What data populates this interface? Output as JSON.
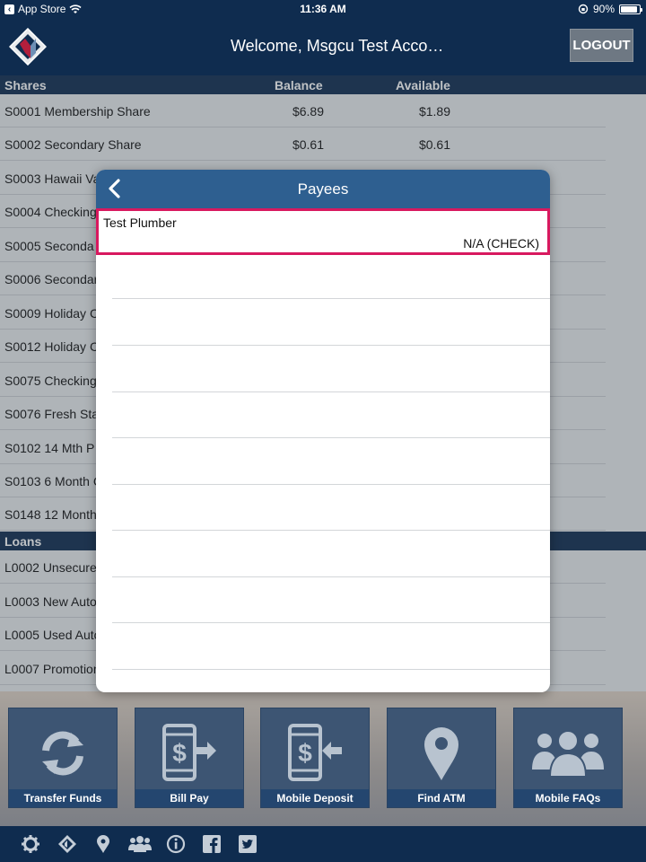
{
  "status_bar": {
    "back_app": "App Store",
    "time": "11:36 AM",
    "battery": "90%",
    "battery_level": 0.9
  },
  "header": {
    "welcome": "Welcome, Msgcu Test Acco…",
    "logout_label": "LOGOUT"
  },
  "shares": {
    "title": "Shares",
    "col_balance": "Balance",
    "col_available": "Available",
    "rows": [
      {
        "name": "S0001 Membership Share",
        "balance": "$6.89",
        "available": "$1.89"
      },
      {
        "name": "S0002 Secondary Share",
        "balance": "$0.61",
        "available": "$0.61"
      },
      {
        "name": "S0003 Hawaii Va",
        "balance": "",
        "available": ""
      },
      {
        "name": "S0004 Checking",
        "balance": "",
        "available": ""
      },
      {
        "name": "S0005 Seconda",
        "balance": "",
        "available": ""
      },
      {
        "name": "S0006 Secondar",
        "balance": "",
        "available": ""
      },
      {
        "name": "S0009 Holiday C",
        "balance": "",
        "available": ""
      },
      {
        "name": "S0012 Holiday C",
        "balance": "",
        "available": ""
      },
      {
        "name": "S0075 Checking",
        "balance": "",
        "available": ""
      },
      {
        "name": "S0076 Fresh Sta",
        "balance": "",
        "available": ""
      },
      {
        "name": "S0102 14 Mth P",
        "balance": "",
        "available": ""
      },
      {
        "name": "S0103 6 Month C",
        "balance": "",
        "available": ""
      },
      {
        "name": "S0148 12 Month",
        "balance": "",
        "available": ""
      }
    ]
  },
  "loans": {
    "title": "Loans",
    "rows": [
      {
        "name": "L0002 Unsecure"
      },
      {
        "name": "L0003 New Auto"
      },
      {
        "name": "L0005 Used Auto"
      },
      {
        "name": "L0007 Promotion"
      }
    ]
  },
  "modal": {
    "title": "Payees",
    "payee": {
      "name": "Test Plumber",
      "type": "N/A (CHECK)"
    }
  },
  "tiles": [
    {
      "label": "Transfer Funds",
      "icon": "refresh-icon"
    },
    {
      "label": "Bill Pay",
      "icon": "phone-dollar-out-icon"
    },
    {
      "label": "Mobile Deposit",
      "icon": "phone-dollar-in-icon"
    },
    {
      "label": "Find ATM",
      "icon": "map-pin-icon"
    },
    {
      "label": "Mobile FAQs",
      "icon": "people-icon"
    }
  ],
  "toolbar_icons": [
    "gear-icon",
    "logo-icon",
    "location-icon",
    "people-icon",
    "info-icon",
    "facebook-icon",
    "twitter-icon"
  ],
  "colors": {
    "navy": "#0f2c4f",
    "modal_header": "#2e5f90",
    "highlight": "#d8195f",
    "tile": "#3d5573"
  }
}
